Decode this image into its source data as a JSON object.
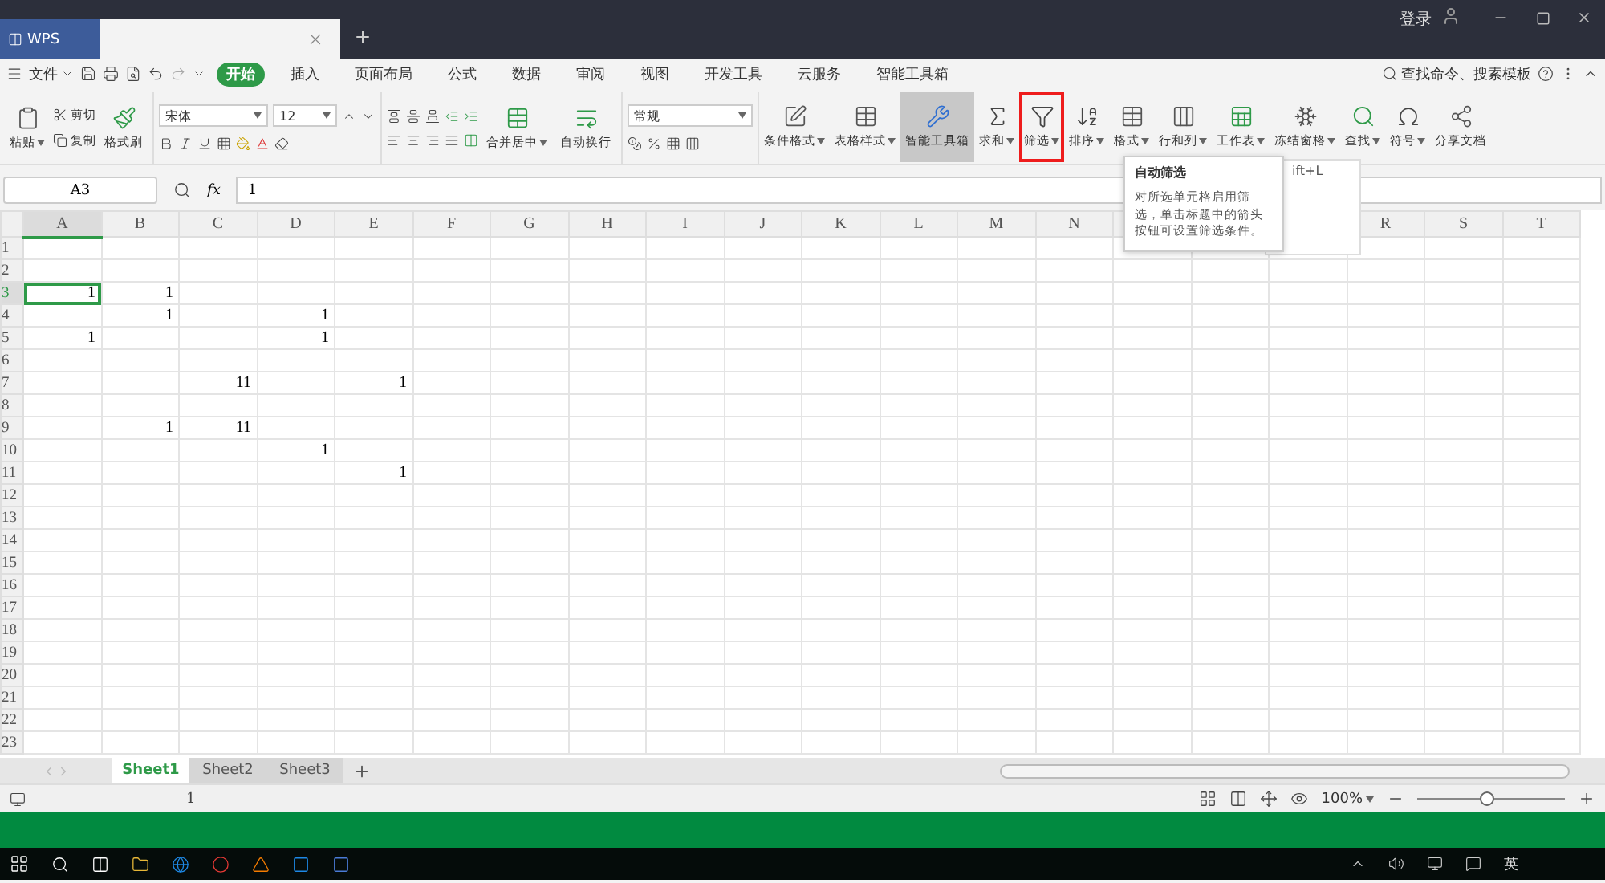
{
  "title_bar": {
    "app_tab": "WPS",
    "login": "登录"
  },
  "menu": {
    "file": "文件",
    "tabs": [
      {
        "label": "开始",
        "selected": true
      },
      {
        "label": "插入",
        "selected": false
      },
      {
        "label": "页面布局",
        "selected": false
      },
      {
        "label": "公式",
        "selected": false
      },
      {
        "label": "数据",
        "selected": false
      },
      {
        "label": "审阅",
        "selected": false
      },
      {
        "label": "视图",
        "selected": false
      },
      {
        "label": "开发工具",
        "selected": false
      },
      {
        "label": "云服务",
        "selected": false
      },
      {
        "label": "智能工具箱",
        "selected": false
      }
    ],
    "search": "查找命令、搜索模板"
  },
  "ribbon": {
    "paste": "粘贴",
    "cut": "剪切",
    "copy": "复制",
    "format_painter": "格式刷",
    "font_name": "宋体",
    "font_size": "12",
    "merge": "合并居中",
    "wrap": "自动换行",
    "number_format": "常规",
    "tools": [
      {
        "kind": "conditional",
        "label": "条件格式",
        "menu": true,
        "active": false,
        "highlighted": false
      },
      {
        "kind": "table-style",
        "label": "表格样式",
        "menu": true,
        "active": false,
        "highlighted": false
      },
      {
        "kind": "toolbox",
        "label": "智能工具箱",
        "menu": false,
        "active": true,
        "highlighted": false
      },
      {
        "kind": "sum",
        "label": "求和",
        "menu": true,
        "active": false,
        "highlighted": false
      },
      {
        "kind": "filter",
        "label": "筛选",
        "menu": true,
        "active": false,
        "highlighted": true
      },
      {
        "kind": "sort",
        "label": "排序",
        "menu": true,
        "active": false,
        "highlighted": false
      },
      {
        "kind": "format",
        "label": "格式",
        "menu": true,
        "active": false,
        "highlighted": false
      },
      {
        "kind": "rowcol",
        "label": "行和列",
        "menu": true,
        "active": false,
        "highlighted": false
      },
      {
        "kind": "sheet",
        "label": "工作表",
        "menu": true,
        "active": false,
        "highlighted": false
      },
      {
        "kind": "freeze",
        "label": "冻结窗格",
        "menu": true,
        "active": false,
        "highlighted": false
      },
      {
        "kind": "find",
        "label": "查找",
        "menu": true,
        "active": false,
        "highlighted": false
      },
      {
        "kind": "symbol",
        "label": "符号",
        "menu": true,
        "active": false,
        "highlighted": false
      },
      {
        "kind": "share",
        "label": "分享文档",
        "menu": false,
        "active": false,
        "highlighted": false
      }
    ]
  },
  "tooltip": {
    "shortcut_fragment": "ift+L",
    "title": "自动筛选",
    "text": "对所选单元格启用筛选，单击标题中的箭头按钮可设置筛选条件。"
  },
  "formula_bar": {
    "cell": "A3",
    "fx": "fx",
    "value": "1"
  },
  "sheet": {
    "columns": [
      "A",
      "B",
      "C",
      "D",
      "E",
      "F",
      "G",
      "H",
      "I",
      "J",
      "K",
      "L",
      "M",
      "N",
      null,
      null,
      null,
      "R",
      "S",
      "T"
    ],
    "rows": [
      {
        "label": "1"
      },
      {
        "label": "2"
      },
      {
        "label": "3",
        "cells": [
          {
            "text": "1",
            "selected": true
          },
          {
            "text": "1",
            "selected": false
          }
        ]
      },
      {
        "label": "4",
        "cells": [
          null,
          {
            "text": "1",
            "selected": false
          },
          null,
          {
            "text": "1",
            "selected": false
          }
        ]
      },
      {
        "label": "5",
        "cells": [
          {
            "text": "1",
            "selected": false
          },
          null,
          null,
          {
            "text": "1",
            "selected": false
          }
        ]
      },
      {
        "label": "6"
      },
      {
        "label": "7",
        "cells": [
          null,
          null,
          {
            "text": "11",
            "selected": false
          },
          null,
          {
            "text": "1",
            "selected": false
          }
        ]
      },
      {
        "label": "8"
      },
      {
        "label": "9",
        "cells": [
          null,
          {
            "text": "1",
            "selected": false
          },
          {
            "text": "11",
            "selected": false
          }
        ]
      },
      {
        "label": "10",
        "cells": [
          null,
          null,
          null,
          {
            "text": "1",
            "selected": false
          }
        ]
      },
      {
        "label": "11",
        "cells": [
          null,
          null,
          null,
          null,
          {
            "text": "1",
            "selected": false
          }
        ]
      },
      {
        "label": "12"
      },
      {
        "label": "13"
      },
      {
        "label": "14"
      },
      {
        "label": "15"
      },
      {
        "label": "16"
      },
      {
        "label": "17"
      },
      {
        "label": "18"
      },
      {
        "label": "19"
      },
      {
        "label": "20"
      },
      {
        "label": "21"
      },
      {
        "label": "22"
      },
      {
        "label": "23"
      }
    ]
  },
  "sheet_tabs": [
    {
      "label": "Sheet1",
      "selected": true
    },
    {
      "label": "Sheet2",
      "selected": false
    },
    {
      "label": "Sheet3",
      "selected": false
    }
  ],
  "status_bar": {
    "value": "1",
    "zoom": "100%",
    "zoom_slider": {
      "level": 0.47
    }
  },
  "tray": {
    "input_method": "英"
  }
}
